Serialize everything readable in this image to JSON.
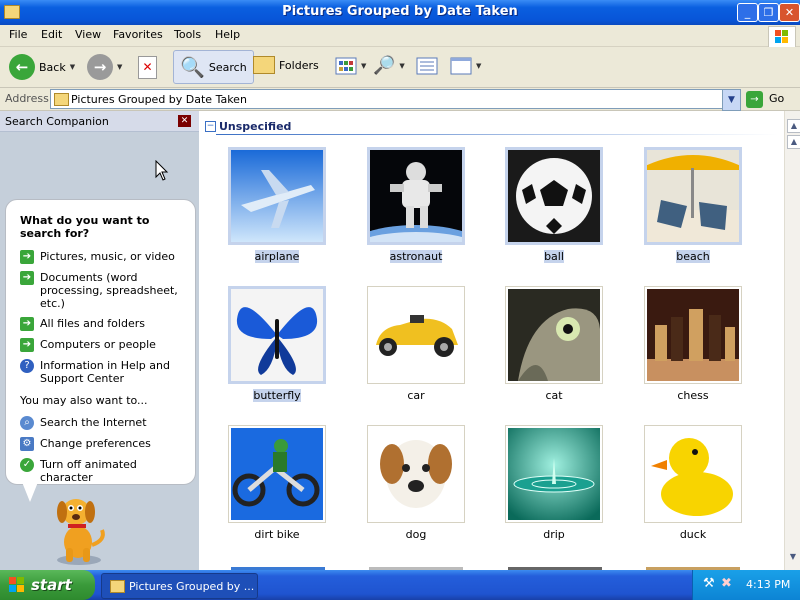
{
  "window": {
    "title": "Pictures Grouped by Date Taken"
  },
  "menu": [
    "File",
    "Edit",
    "View",
    "Favorites",
    "Tools",
    "Help"
  ],
  "toolbar": {
    "back": "Back",
    "search": "Search",
    "folders": "Folders"
  },
  "address": {
    "label": "Address",
    "value": "Pictures Grouped by Date Taken",
    "go": "Go"
  },
  "search_companion": {
    "title": "Search Companion",
    "question": "What do you want to search for?",
    "options": [
      "Pictures, music, or video",
      "Documents (word processing, spreadsheet, etc.)",
      "All files and folders",
      "Computers or people",
      "Information in Help and Support Center"
    ],
    "also_label": "You may also want to...",
    "also": [
      "Search the Internet",
      "Change preferences",
      "Turn off animated character"
    ]
  },
  "group": {
    "title": "Unspecified"
  },
  "items": [
    {
      "label": "airplane",
      "selected": true
    },
    {
      "label": "astronaut",
      "selected": true
    },
    {
      "label": "ball",
      "selected": true
    },
    {
      "label": "beach",
      "selected": true
    },
    {
      "label": "butterfly",
      "selected": true
    },
    {
      "label": "car",
      "selected": false
    },
    {
      "label": "cat",
      "selected": false
    },
    {
      "label": "chess",
      "selected": false
    },
    {
      "label": "dirt bike",
      "selected": false
    },
    {
      "label": "dog",
      "selected": false
    },
    {
      "label": "drip",
      "selected": false
    },
    {
      "label": "duck",
      "selected": false
    }
  ],
  "taskbar": {
    "start": "start",
    "task": "Pictures Grouped by ...",
    "clock": "4:13 PM"
  }
}
